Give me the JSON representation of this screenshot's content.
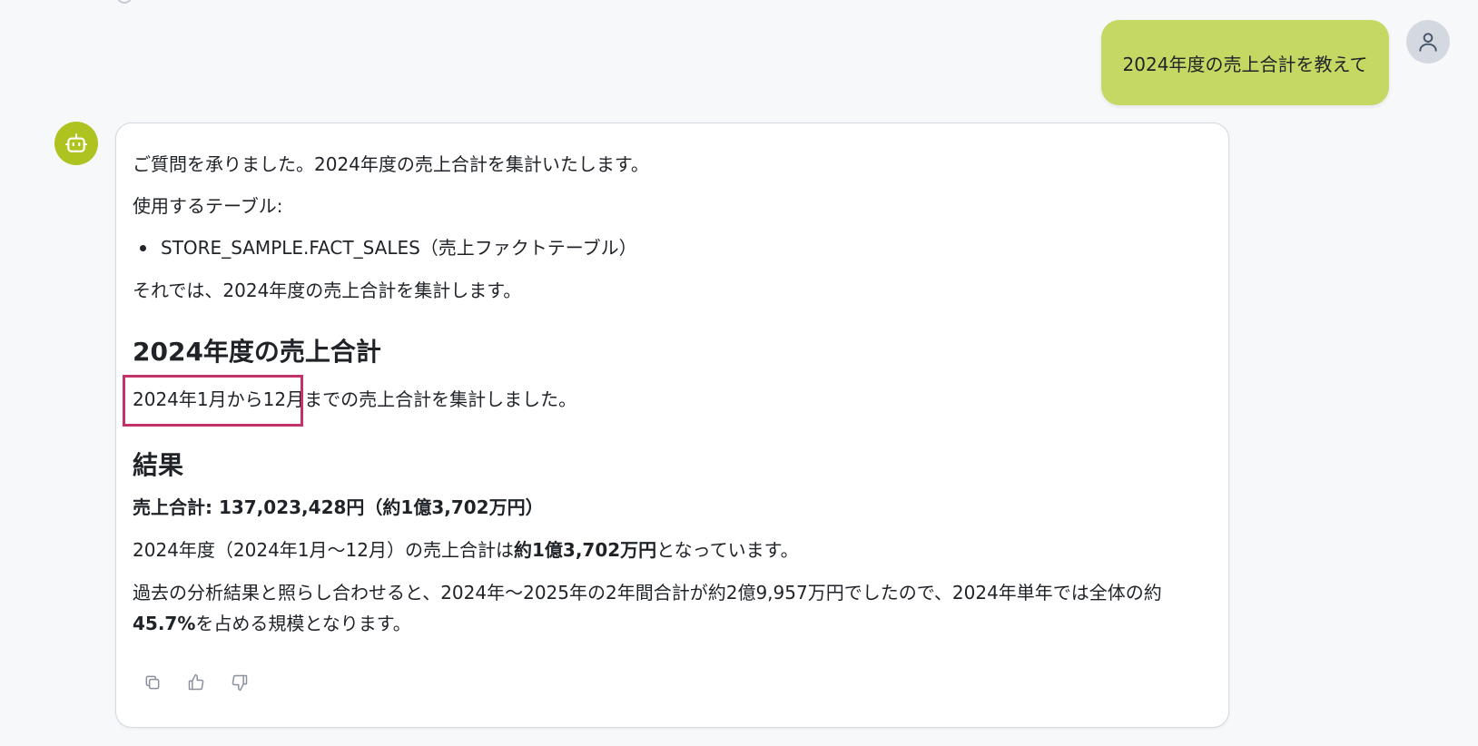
{
  "user_message": "2024年度の売上合計を教えて",
  "assistant": {
    "intro": "ご質問を承りました。2024年度の売上合計を集計いたします。",
    "tables_label": "使用するテーブル:",
    "tables": [
      "STORE_SAMPLE.FACT_SALES（売上ファクトテーブル）"
    ],
    "transition": "それでは、2024年度の売上合計を集計します。",
    "section_title": "2024年度の売上合計",
    "period_highlight": "2024年1月から12月",
    "period_rest": "までの売上合計を集計しました。",
    "result_title": "結果",
    "total_line": "売上合計: 137,023,428円（約1億3,702万円）",
    "summary_pre": "2024年度（2024年1月〜12月）の売上合計は",
    "summary_bold": "約1億3,702万円",
    "summary_post": "となっています。",
    "comparison_line1": "過去の分析結果と照らし合わせると、2024年〜2025年の2年間合計が約2億9,957万円でしたので、2024年単年では全体の約",
    "comparison_bold": "45.7%",
    "comparison_line2_post": "を占める規模となります。"
  },
  "actions": {
    "copy_icon": "copy-icon",
    "like_icon": "thumbs-up-icon",
    "dislike_icon": "thumbs-down-icon"
  },
  "colors": {
    "user_bubble": "#c5d863",
    "bot_avatar": "#aec320",
    "highlight_border": "#c4326a"
  }
}
